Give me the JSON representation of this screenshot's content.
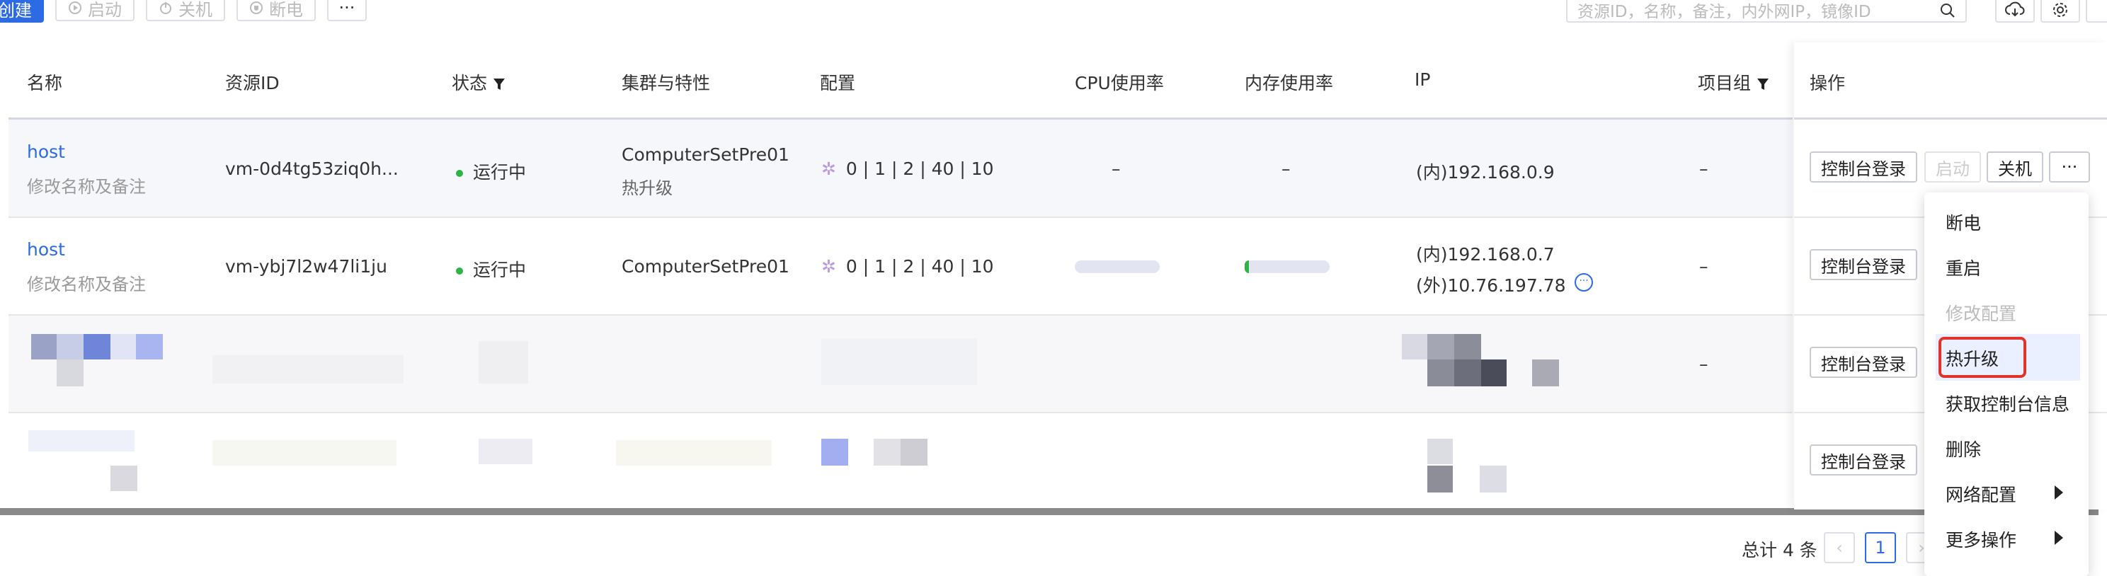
{
  "toolbar": {
    "create_label": "创建",
    "start_label": "启动",
    "shutdown_label": "关机",
    "poweroff_label": "断电",
    "more_label": "···",
    "search_placeholder": "资源ID，名称，备注，内外网IP，镜像ID"
  },
  "table": {
    "columns": {
      "name": "名称",
      "resource_id": "资源ID",
      "status": "状态",
      "cluster": "集群与特性",
      "config": "配置",
      "cpu": "CPU使用率",
      "mem": "内存使用率",
      "ip": "IP",
      "project": "项目组",
      "ops": "操作"
    },
    "rows": [
      {
        "name": "host",
        "remark": "修改名称及备注",
        "resource_id": "vm-0d4tg53ziq0h...",
        "status": "运行中",
        "cluster": "ComputerSetPre01",
        "feature": "热升级",
        "config": "0 | 1 | 2 | 40 | 10",
        "cpu": "–",
        "mem": "–",
        "ip_inner": "(内)192.168.0.9",
        "project": "–",
        "console_label": "控制台登录",
        "start_label": "启动",
        "shutdown_label": "关机",
        "more_label": "···"
      },
      {
        "name": "host",
        "remark": "修改名称及备注",
        "resource_id": "vm-ybj7l2w47li1ju",
        "status": "运行中",
        "cluster": "ComputerSetPre01",
        "config": "0 | 1 | 2 | 40 | 10",
        "ip_inner": "(内)192.168.0.7",
        "ip_outer": "(外)10.76.197.78",
        "ip_more": "···",
        "project": "–",
        "console_label": "控制台登录"
      },
      {
        "project": "–",
        "console_label": "控制台登录"
      },
      {
        "console_label": "控制台登录"
      }
    ]
  },
  "menu": {
    "items": [
      {
        "label": "断电"
      },
      {
        "label": "重启"
      },
      {
        "label": "修改配置"
      },
      {
        "label": "热升级"
      },
      {
        "label": "获取控制台信息"
      },
      {
        "label": "删除"
      },
      {
        "label": "网络配置"
      },
      {
        "label": "更多操作"
      }
    ]
  },
  "pagination": {
    "total_label": "总计 4 条",
    "current_page": "1"
  }
}
